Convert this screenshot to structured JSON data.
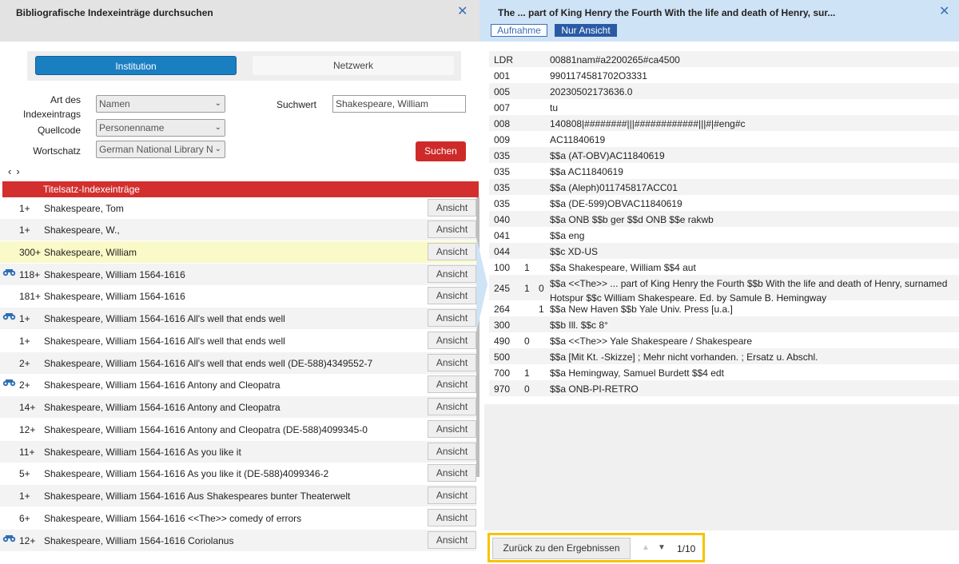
{
  "left": {
    "title": "Bibliografische Indexeinträge durchsuchen",
    "close": "✕",
    "tabs": {
      "institution": "Institution",
      "network": "Netzwerk"
    },
    "form": {
      "art_label": "Art des Indexeintrags",
      "art_value": "Namen",
      "quell_label": "Quellcode",
      "quell_value": "Personenname",
      "wort_label": "Wortschatz",
      "wort_value": "German National Library Na",
      "suchwert_label": "Suchwert",
      "suchwert_value": "Shakespeare, William",
      "search_button": "Suchen"
    },
    "nav": {
      "prev": "‹",
      "next": "›"
    },
    "list_header": "Titelsatz-Indexeinträge",
    "view_label": "Ansicht",
    "rows": [
      {
        "count": "1+",
        "term": "Shakespeare, Tom",
        "icon": ""
      },
      {
        "count": "1+",
        "term": "Shakespeare, W.,",
        "icon": ""
      },
      {
        "count": "300+",
        "term": "Shakespeare, William",
        "icon": ""
      },
      {
        "count": "118+",
        "term": "Shakespeare, William 1564-1616",
        "icon": "binoculars-icon"
      },
      {
        "count": "181+",
        "term": "Shakespeare, William 1564-1616",
        "icon": ""
      },
      {
        "count": "1+",
        "term": "Shakespeare, William 1564-1616 All's well that ends well",
        "icon": "binoculars-icon"
      },
      {
        "count": "1+",
        "term": "Shakespeare, William 1564-1616 All's well that ends well",
        "icon": ""
      },
      {
        "count": "2+",
        "term": "Shakespeare, William 1564-1616 All's well that ends well (DE-588)4349552-7",
        "icon": ""
      },
      {
        "count": "2+",
        "term": "Shakespeare, William 1564-1616 Antony and Cleopatra",
        "icon": "binoculars-icon"
      },
      {
        "count": "14+",
        "term": "Shakespeare, William 1564-1616 Antony and Cleopatra",
        "icon": ""
      },
      {
        "count": "12+",
        "term": "Shakespeare, William 1564-1616 Antony and Cleopatra (DE-588)4099345-0",
        "icon": ""
      },
      {
        "count": "11+",
        "term": "Shakespeare, William 1564-1616 As you like it",
        "icon": ""
      },
      {
        "count": "5+",
        "term": "Shakespeare, William 1564-1616 As you like it (DE-588)4099346-2",
        "icon": ""
      },
      {
        "count": "1+",
        "term": "Shakespeare, William 1564-1616 Aus Shakespeares bunter Theaterwelt",
        "icon": ""
      },
      {
        "count": "6+",
        "term": "Shakespeare, William 1564-1616 <<The>> comedy of errors",
        "icon": ""
      },
      {
        "count": "12+",
        "term": "Shakespeare, William 1564-1616 Coriolanus",
        "icon": "binoculars-icon"
      }
    ]
  },
  "right": {
    "title": "The ... part of King Henry the Fourth With the life and death of Henry, sur...",
    "close": "✕",
    "btn_record": "Aufnahme",
    "btn_view_only": "Nur Ansicht",
    "record": [
      {
        "tag": "LDR",
        "i1": "",
        "i2": "",
        "value": "00881nam#a2200265#ca4500"
      },
      {
        "tag": "001",
        "i1": "",
        "i2": "",
        "value": "9901174581702O3331"
      },
      {
        "tag": "005",
        "i1": "",
        "i2": "",
        "value": "20230502173636.0"
      },
      {
        "tag": "007",
        "i1": "",
        "i2": "",
        "value": "tu"
      },
      {
        "tag": "008",
        "i1": "",
        "i2": "",
        "value": "140808|########|||############|||#|#eng#c"
      },
      {
        "tag": "009",
        "i1": "",
        "i2": "",
        "value": "AC11840619"
      },
      {
        "tag": "035",
        "i1": "",
        "i2": "",
        "value": "$$a (AT-OBV)AC11840619"
      },
      {
        "tag": "035",
        "i1": "",
        "i2": "",
        "value": "$$a AC11840619"
      },
      {
        "tag": "035",
        "i1": "",
        "i2": "",
        "value": "$$a (Aleph)011745817ACC01"
      },
      {
        "tag": "035",
        "i1": "",
        "i2": "",
        "value": "$$a (DE-599)OBVAC11840619"
      },
      {
        "tag": "040",
        "i1": "",
        "i2": "",
        "value": "$$a ONB $$b ger $$d ONB $$e rakwb"
      },
      {
        "tag": "041",
        "i1": "",
        "i2": "",
        "value": "$$a eng"
      },
      {
        "tag": "044",
        "i1": "",
        "i2": "",
        "value": "$$c XD-US"
      },
      {
        "tag": "100",
        "i1": "1",
        "i2": "",
        "value": "$$a Shakespeare, William $$4 aut"
      },
      {
        "tag": "245",
        "i1": "1",
        "i2": "0",
        "value": "$$a <<The>> ... part of King Henry the Fourth $$b With the life and death of Henry, surnamed Hotspur $$c William Shakespeare. Ed. by Samule B. Hemingway"
      },
      {
        "tag": "264",
        "i1": "",
        "i2": "1",
        "value": "$$a New Haven $$b Yale Univ. Press [u.a.]"
      },
      {
        "tag": "300",
        "i1": "",
        "i2": "",
        "value": "$$b Ill. $$c 8°"
      },
      {
        "tag": "490",
        "i1": "0",
        "i2": "",
        "value": "$$a <<The>> Yale Shakespeare / Shakespeare"
      },
      {
        "tag": "500",
        "i1": "",
        "i2": "",
        "value": "$$a [Mit Kt. -Skizze] ; Mehr nicht vorhanden. ; Ersatz u. Abschl."
      },
      {
        "tag": "700",
        "i1": "1",
        "i2": "",
        "value": "$$a Hemingway, Samuel Burdett $$4 edt"
      },
      {
        "tag": "970",
        "i1": "0",
        "i2": "",
        "value": "$$a ONB-PI-RETRO"
      }
    ],
    "footer": {
      "back": "Zurück zu den Ergebnissen",
      "up": "▲",
      "down": "▼",
      "pager": "1/10"
    }
  }
}
